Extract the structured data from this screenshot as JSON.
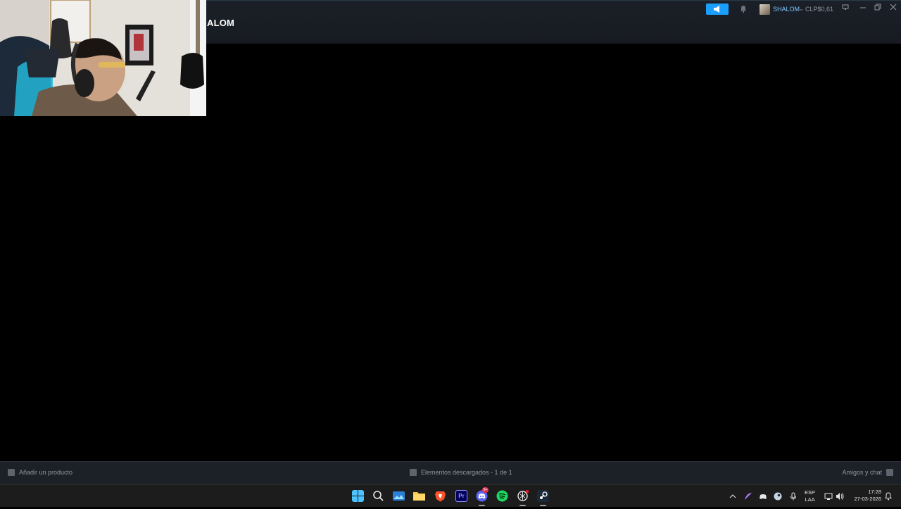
{
  "header": {
    "title": "ALOM",
    "broadcast_icon": "megaphone-icon",
    "notifications_icon": "bell-icon",
    "username": "SHALOM",
    "balance": "CLP$0,61",
    "window_controls": [
      "monitor-icon",
      "minimize-icon",
      "restore-icon",
      "close-icon"
    ],
    "accent": "#1a9fff"
  },
  "bottom_bar": {
    "add_product": "Añadir un producto",
    "downloads": "Elementos descargados - 1 de 1",
    "friends_chat": "Amigos y chat"
  },
  "taskbar": {
    "apps": [
      "windows-start-icon",
      "search-icon",
      "photos-icon",
      "file-explorer-icon",
      "brave-browser-icon",
      "premiere-pro-icon",
      "discord-icon",
      "spotify-icon",
      "chatgpt-icon",
      "steam-icon"
    ],
    "premiere_label": "Pr",
    "discord_badge": "9+",
    "tray": {
      "language": "ESP",
      "layout": "LAA",
      "time": "17:28",
      "date": "27-03-2026"
    }
  }
}
